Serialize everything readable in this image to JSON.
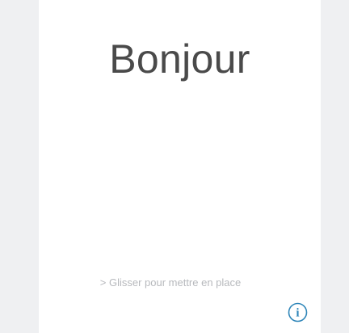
{
  "lock_screen": {
    "greeting": "Bonjour",
    "slide_hint": "> Glisser pour mettre en place",
    "info_icon": "info-circle-icon",
    "info_glyph": "i"
  },
  "colors": {
    "background": "#eff0f2",
    "panel": "#ffffff",
    "greeting_text": "#4a4a4a",
    "hint_text": "#b7b9bd",
    "info_accent": "#2f86b9"
  }
}
